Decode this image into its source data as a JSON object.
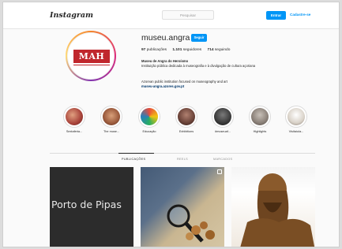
{
  "header": {
    "logo": "Instagram",
    "search_placeholder": "Pesquisar",
    "login_label": "Entrar",
    "signup_label": "Cadastre-se"
  },
  "profile": {
    "avatar_text": "MAH",
    "username": "museu.angra",
    "follow_label": "Seguir",
    "stats": [
      {
        "value": "97",
        "label": "publicações"
      },
      {
        "value": "1.101",
        "label": "seguidores"
      },
      {
        "value": "714",
        "label": "seguindo"
      }
    ],
    "bio_name": "Museu de Angra do Heroísmo",
    "bio_line1": "Instituição pública dedicada à museografia e à divulgação de cultura açoriana",
    "bio_line2": "Azorean public institution focused on museography and art",
    "bio_link": "museu-angra.azores.gov.pt"
  },
  "highlights": [
    {
      "label": "Sextaferia...",
      "color": "#a8423a"
    },
    {
      "label": "The muse...",
      "color": "#9b5a3c"
    },
    {
      "label": "Educação",
      "color": "#c27a4a"
    },
    {
      "label": "Exhibitions",
      "color": "#6a4238"
    },
    {
      "label": "#museuaf...",
      "color": "#3a3a3a"
    },
    {
      "label": "Highlights",
      "color": "#8a8078"
    },
    {
      "label": "Visitaíula...",
      "color": "#d9d2c8"
    }
  ],
  "tabs": [
    {
      "label": "Publicações",
      "active": true
    },
    {
      "label": "Reels",
      "active": false
    },
    {
      "label": "Marcados",
      "active": false
    }
  ],
  "posts": [
    {
      "text": "Porto de Pipas"
    },
    {
      "text": ""
    },
    {
      "text": ""
    }
  ]
}
